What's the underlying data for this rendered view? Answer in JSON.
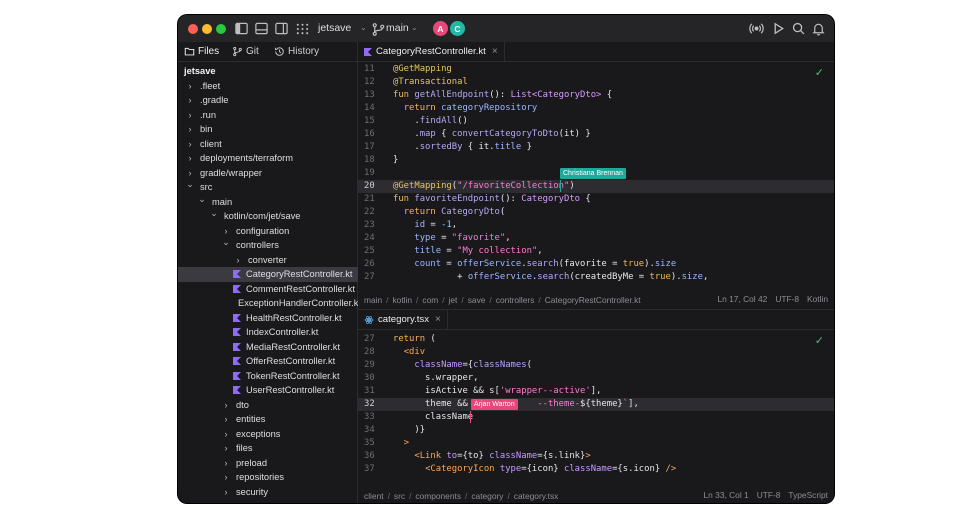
{
  "window": {
    "project": "jetsave",
    "branch": "main",
    "avatars": [
      {
        "initial": "A",
        "color": "#e8477c"
      },
      {
        "initial": "C",
        "color": "#21b8a4"
      }
    ]
  },
  "sidebar": {
    "tabs": [
      {
        "label": "Files",
        "icon": "folder-icon"
      },
      {
        "label": "Git",
        "icon": "branch-icon"
      },
      {
        "label": "History",
        "icon": "history-icon"
      }
    ],
    "tree": [
      {
        "name": "jetsave",
        "depth": 0,
        "type": "root"
      },
      {
        "name": ".fleet",
        "depth": 0,
        "type": "folder",
        "open": false
      },
      {
        "name": ".gradle",
        "depth": 0,
        "type": "folder",
        "open": false
      },
      {
        "name": ".run",
        "depth": 0,
        "type": "folder",
        "open": false
      },
      {
        "name": "bin",
        "depth": 0,
        "type": "folder",
        "open": false
      },
      {
        "name": "client",
        "depth": 0,
        "type": "folder",
        "open": false
      },
      {
        "name": "deployments/terraform",
        "depth": 0,
        "type": "folder",
        "open": false
      },
      {
        "name": "gradle/wrapper",
        "depth": 0,
        "type": "folder",
        "open": false
      },
      {
        "name": "src",
        "depth": 0,
        "type": "folder",
        "open": true
      },
      {
        "name": "main",
        "depth": 1,
        "type": "folder",
        "open": true
      },
      {
        "name": "kotlin/com/jet/save",
        "depth": 2,
        "type": "folder",
        "open": true
      },
      {
        "name": "configuration",
        "depth": 3,
        "type": "folder",
        "open": false
      },
      {
        "name": "controllers",
        "depth": 3,
        "type": "folder",
        "open": true
      },
      {
        "name": "converter",
        "depth": 4,
        "type": "folder",
        "open": false
      },
      {
        "name": "CategoryRestController.kt",
        "depth": 4,
        "type": "kt",
        "selected": true
      },
      {
        "name": "CommentRestController.kt",
        "depth": 4,
        "type": "kt"
      },
      {
        "name": "ExceptionHandlerController.kt",
        "depth": 4,
        "type": "kt"
      },
      {
        "name": "HealthRestController.kt",
        "depth": 4,
        "type": "kt"
      },
      {
        "name": "IndexController.kt",
        "depth": 4,
        "type": "kt"
      },
      {
        "name": "MediaRestController.kt",
        "depth": 4,
        "type": "kt"
      },
      {
        "name": "OfferRestController.kt",
        "depth": 4,
        "type": "kt"
      },
      {
        "name": "TokenRestController.kt",
        "depth": 4,
        "type": "kt"
      },
      {
        "name": "UserRestController.kt",
        "depth": 4,
        "type": "kt"
      },
      {
        "name": "dto",
        "depth": 3,
        "type": "folder",
        "open": false
      },
      {
        "name": "entities",
        "depth": 3,
        "type": "folder",
        "open": false
      },
      {
        "name": "exceptions",
        "depth": 3,
        "type": "folder",
        "open": false
      },
      {
        "name": "files",
        "depth": 3,
        "type": "folder",
        "open": false
      },
      {
        "name": "preload",
        "depth": 3,
        "type": "folder",
        "open": false
      },
      {
        "name": "repositories",
        "depth": 3,
        "type": "folder",
        "open": false
      },
      {
        "name": "security",
        "depth": 3,
        "type": "folder",
        "open": false
      }
    ]
  },
  "editor1": {
    "tab_label": "CategoryRestController.kt",
    "collaborator": {
      "name": "Christiana Brennan",
      "color": "#1fa99a"
    },
    "lines": [
      {
        "n": "11",
        "tokens": [
          [
            "ann",
            "@GetMapping"
          ]
        ]
      },
      {
        "n": "12",
        "tokens": [
          [
            "ann",
            "@Transactional"
          ]
        ]
      },
      {
        "n": "13",
        "tokens": [
          [
            "kw",
            "fun "
          ],
          [
            "fn",
            "getAllEndpoint"
          ],
          [
            "plain",
            "(): "
          ],
          [
            "typ",
            "List<CategoryDto>"
          ],
          [
            "plain",
            " {"
          ]
        ]
      },
      {
        "n": "14",
        "tokens": [
          [
            "plain",
            "  "
          ],
          [
            "kw",
            "return "
          ],
          [
            "prop",
            "categoryRepository"
          ]
        ]
      },
      {
        "n": "15",
        "tokens": [
          [
            "plain",
            "    ."
          ],
          [
            "fn",
            "findAll"
          ],
          [
            "plain",
            "()"
          ]
        ]
      },
      {
        "n": "16",
        "tokens": [
          [
            "plain",
            "    ."
          ],
          [
            "fn",
            "map"
          ],
          [
            "plain",
            " { "
          ],
          [
            "fn",
            "convertCategoryToDto"
          ],
          [
            "plain",
            "(it) }"
          ]
        ]
      },
      {
        "n": "17",
        "tokens": [
          [
            "plain",
            "    ."
          ],
          [
            "fn",
            "sortedBy"
          ],
          [
            "plain",
            " { it."
          ],
          [
            "prop",
            "title"
          ],
          [
            "plain",
            " }"
          ]
        ]
      },
      {
        "n": "18",
        "tokens": [
          [
            "plain",
            "}"
          ]
        ]
      },
      {
        "n": "19",
        "tokens": []
      },
      {
        "n": "20",
        "tokens": [
          [
            "ann",
            "@GetMapping"
          ],
          [
            "plain",
            "("
          ],
          [
            "str",
            "\"/favoriteCollection\""
          ],
          [
            "plain",
            ")"
          ]
        ],
        "hl": true
      },
      {
        "n": "21",
        "tokens": [
          [
            "kw",
            "fun "
          ],
          [
            "fn",
            "favoriteEndpoint"
          ],
          [
            "plain",
            "(): "
          ],
          [
            "typ",
            "CategoryDto"
          ],
          [
            "plain",
            " {"
          ]
        ]
      },
      {
        "n": "22",
        "tokens": [
          [
            "plain",
            "  "
          ],
          [
            "kw",
            "return "
          ],
          [
            "fn",
            "CategoryDto"
          ],
          [
            "plain",
            "("
          ]
        ]
      },
      {
        "n": "23",
        "tokens": [
          [
            "plain",
            "    "
          ],
          [
            "prop",
            "id"
          ],
          [
            "plain",
            " = "
          ],
          [
            "num",
            "-1"
          ],
          [
            "plain",
            ","
          ]
        ]
      },
      {
        "n": "24",
        "tokens": [
          [
            "plain",
            "    "
          ],
          [
            "prop",
            "type"
          ],
          [
            "plain",
            " = "
          ],
          [
            "str",
            "\"favorite\""
          ],
          [
            "plain",
            ","
          ]
        ]
      },
      {
        "n": "25",
        "tokens": [
          [
            "plain",
            "    "
          ],
          [
            "prop",
            "title"
          ],
          [
            "plain",
            " = "
          ],
          [
            "str",
            "\"My collection\""
          ],
          [
            "plain",
            ","
          ]
        ]
      },
      {
        "n": "26",
        "tokens": [
          [
            "plain",
            "    "
          ],
          [
            "prop",
            "count"
          ],
          [
            "plain",
            " = "
          ],
          [
            "prop",
            "offerService"
          ],
          [
            "plain",
            "."
          ],
          [
            "fn",
            "search"
          ],
          [
            "plain",
            "(favorite = "
          ],
          [
            "kw",
            "true"
          ],
          [
            "plain",
            ")."
          ],
          [
            "prop",
            "size"
          ]
        ]
      },
      {
        "n": "27",
        "tokens": [
          [
            "plain",
            "            + "
          ],
          [
            "prop",
            "offerService"
          ],
          [
            "plain",
            "."
          ],
          [
            "fn",
            "search"
          ],
          [
            "plain",
            "(createdByMe = "
          ],
          [
            "kw",
            "true"
          ],
          [
            "plain",
            ")."
          ],
          [
            "prop",
            "size"
          ],
          [
            "plain",
            ","
          ]
        ]
      }
    ],
    "breadcrumb": [
      "main",
      "kotlin",
      "com",
      "jet",
      "save",
      "controllers",
      "CategoryRestController.kt"
    ],
    "status": {
      "position": "Ln 17, Col 42",
      "encoding": "UTF-8",
      "language": "Kotlin"
    }
  },
  "editor2": {
    "tab_label": "category.tsx",
    "collaborator": {
      "name": "Arjan Warton",
      "color": "#e8477c"
    },
    "lines": [
      {
        "n": "27",
        "tokens": [
          [
            "kw",
            "return"
          ],
          [
            "plain",
            " ("
          ]
        ]
      },
      {
        "n": "28",
        "tokens": [
          [
            "plain",
            "  "
          ],
          [
            "tag",
            "<div"
          ]
        ]
      },
      {
        "n": "29",
        "tokens": [
          [
            "plain",
            "    "
          ],
          [
            "attr",
            "className"
          ],
          [
            "plain",
            "={"
          ],
          [
            "fn",
            "classNames"
          ],
          [
            "plain",
            "("
          ]
        ]
      },
      {
        "n": "30",
        "tokens": [
          [
            "plain",
            "      s.wrapper,"
          ]
        ]
      },
      {
        "n": "31",
        "tokens": [
          [
            "plain",
            "      isActive && s["
          ],
          [
            "str",
            "'wrapper--active'"
          ],
          [
            "plain",
            "],"
          ]
        ]
      },
      {
        "n": "32",
        "tokens": [
          [
            "plain",
            "      theme && "
          ],
          [
            "plain",
            "            "
          ],
          [
            "str",
            "--theme-"
          ],
          [
            "plain",
            "${theme}"
          ],
          [
            "str",
            "`"
          ],
          [
            "plain",
            "],"
          ]
        ],
        "hl": true
      },
      {
        "n": "33",
        "tokens": [
          [
            "plain",
            "      className"
          ]
        ]
      },
      {
        "n": "34",
        "tokens": [
          [
            "plain",
            "    )}"
          ]
        ]
      },
      {
        "n": "35",
        "tokens": [
          [
            "plain",
            "  "
          ],
          [
            "tag",
            ">"
          ]
        ]
      },
      {
        "n": "36",
        "tokens": [
          [
            "plain",
            "    "
          ],
          [
            "tag",
            "<Link "
          ],
          [
            "attr",
            "to"
          ],
          [
            "plain",
            "={to} "
          ],
          [
            "attr",
            "className"
          ],
          [
            "plain",
            "={s.link}"
          ],
          [
            "tag",
            ">"
          ]
        ]
      },
      {
        "n": "37",
        "tokens": [
          [
            "plain",
            "      "
          ],
          [
            "tag",
            "<CategoryIcon "
          ],
          [
            "attr",
            "type"
          ],
          [
            "plain",
            "={icon} "
          ],
          [
            "attr",
            "className"
          ],
          [
            "plain",
            "={s.icon} "
          ],
          [
            "tag",
            "/>"
          ]
        ]
      }
    ],
    "breadcrumb": [
      "client",
      "src",
      "components",
      "category",
      "category.tsx"
    ],
    "status": {
      "position": "Ln 33, Col 1",
      "encoding": "UTF-8",
      "language": "TypeScript"
    }
  }
}
